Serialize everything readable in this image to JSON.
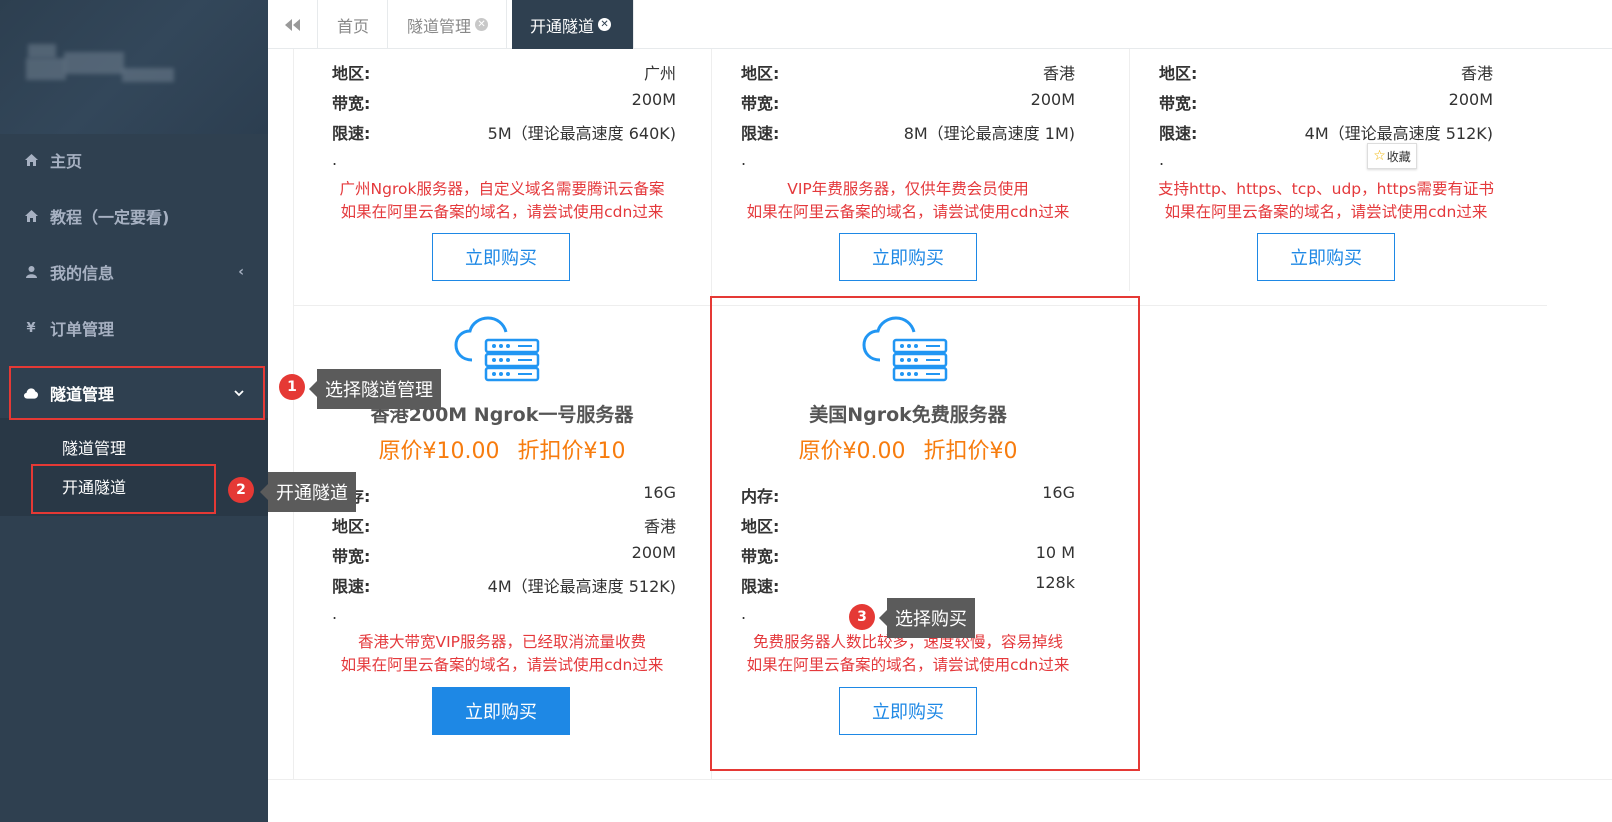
{
  "tabs": {
    "back_icon": "double-left-arrow-icon",
    "items": [
      {
        "label": "首页",
        "closable": false,
        "active": false
      },
      {
        "label": "隧道管理",
        "closable": true,
        "active": false
      },
      {
        "label": "开通隧道",
        "closable": true,
        "active": true
      }
    ]
  },
  "sidebar": {
    "items": [
      {
        "label": "主页",
        "icon": "home-icon"
      },
      {
        "label": "教程（一定要看)",
        "icon": "home-icon"
      },
      {
        "label": "我的信息",
        "icon": "user-icon",
        "arrow": "‹"
      },
      {
        "label": "订单管理",
        "icon": "yen-icon"
      },
      {
        "label": "隧道管理",
        "icon": "cloud-icon",
        "arrow": "⌄",
        "active": true
      }
    ],
    "subitems": [
      {
        "label": "隧道管理"
      },
      {
        "label": "开通隧道"
      }
    ]
  },
  "labels": {
    "memory": "内存:",
    "region": "地区:",
    "bandwidth": "带宽:",
    "speed": "限速:",
    "dot": ".",
    "favorite": "收藏"
  },
  "cards": [
    {
      "region": "广州",
      "bandwidth": "200M",
      "speed": "5M（理论最高速度 640K)",
      "desc1": "广州Ngrok服务器，自定义域名需要腾讯云备案",
      "desc2": "如果在阿里云备案的域名，请尝试使用cdn过来",
      "button": "立即购买"
    },
    {
      "region": "香港",
      "bandwidth": "200M",
      "speed": "8M（理论最高速度 1M)",
      "desc1": "VIP年费服务器，仅供年费会员使用",
      "desc2": "如果在阿里云备案的域名，请尝试使用cdn过来",
      "button": "立即购买"
    },
    {
      "region": "香港",
      "bandwidth": "200M",
      "speed": "4M（理论最高速度 512K)",
      "desc1": "支持http、https、tcp、udp，https需要有证书",
      "desc2": "如果在阿里云备案的域名，请尝试使用cdn过来",
      "button": "立即购买"
    },
    {
      "title": "香港200M Ngrok一号服务器",
      "original_price": "原价¥10.00",
      "discount_price": "折扣价¥10",
      "memory": "16G",
      "region": "香港",
      "bandwidth": "200M",
      "speed": "4M（理论最高速度 512K)",
      "desc1": "香港大带宽VIP服务器，已经取消流量收费",
      "desc2": "如果在阿里云备案的域名，请尝试使用cdn过来",
      "button": "立即购买"
    },
    {
      "title": "美国Ngrok免费服务器",
      "original_price": "原价¥0.00",
      "discount_price": "折扣价¥0",
      "memory": "16G",
      "region": "",
      "bandwidth": "10 M",
      "speed": "128k",
      "desc1": "免费服务器人数比较多，速度较慢，容易掉线",
      "desc2": "如果在阿里云备案的域名，请尝试使用cdn过来",
      "button": "立即购买"
    }
  ],
  "annotations": [
    {
      "number": "1",
      "text": "选择隧道管理"
    },
    {
      "number": "2",
      "text": "开通隧道"
    },
    {
      "number": "3",
      "text": "选择购买"
    }
  ],
  "colors": {
    "sidebar_bg": "#2f4050",
    "accent_blue": "#1e88e5",
    "price_orange": "#f77c0e",
    "desc_red": "#e4393c",
    "highlight_red": "#e53935"
  }
}
